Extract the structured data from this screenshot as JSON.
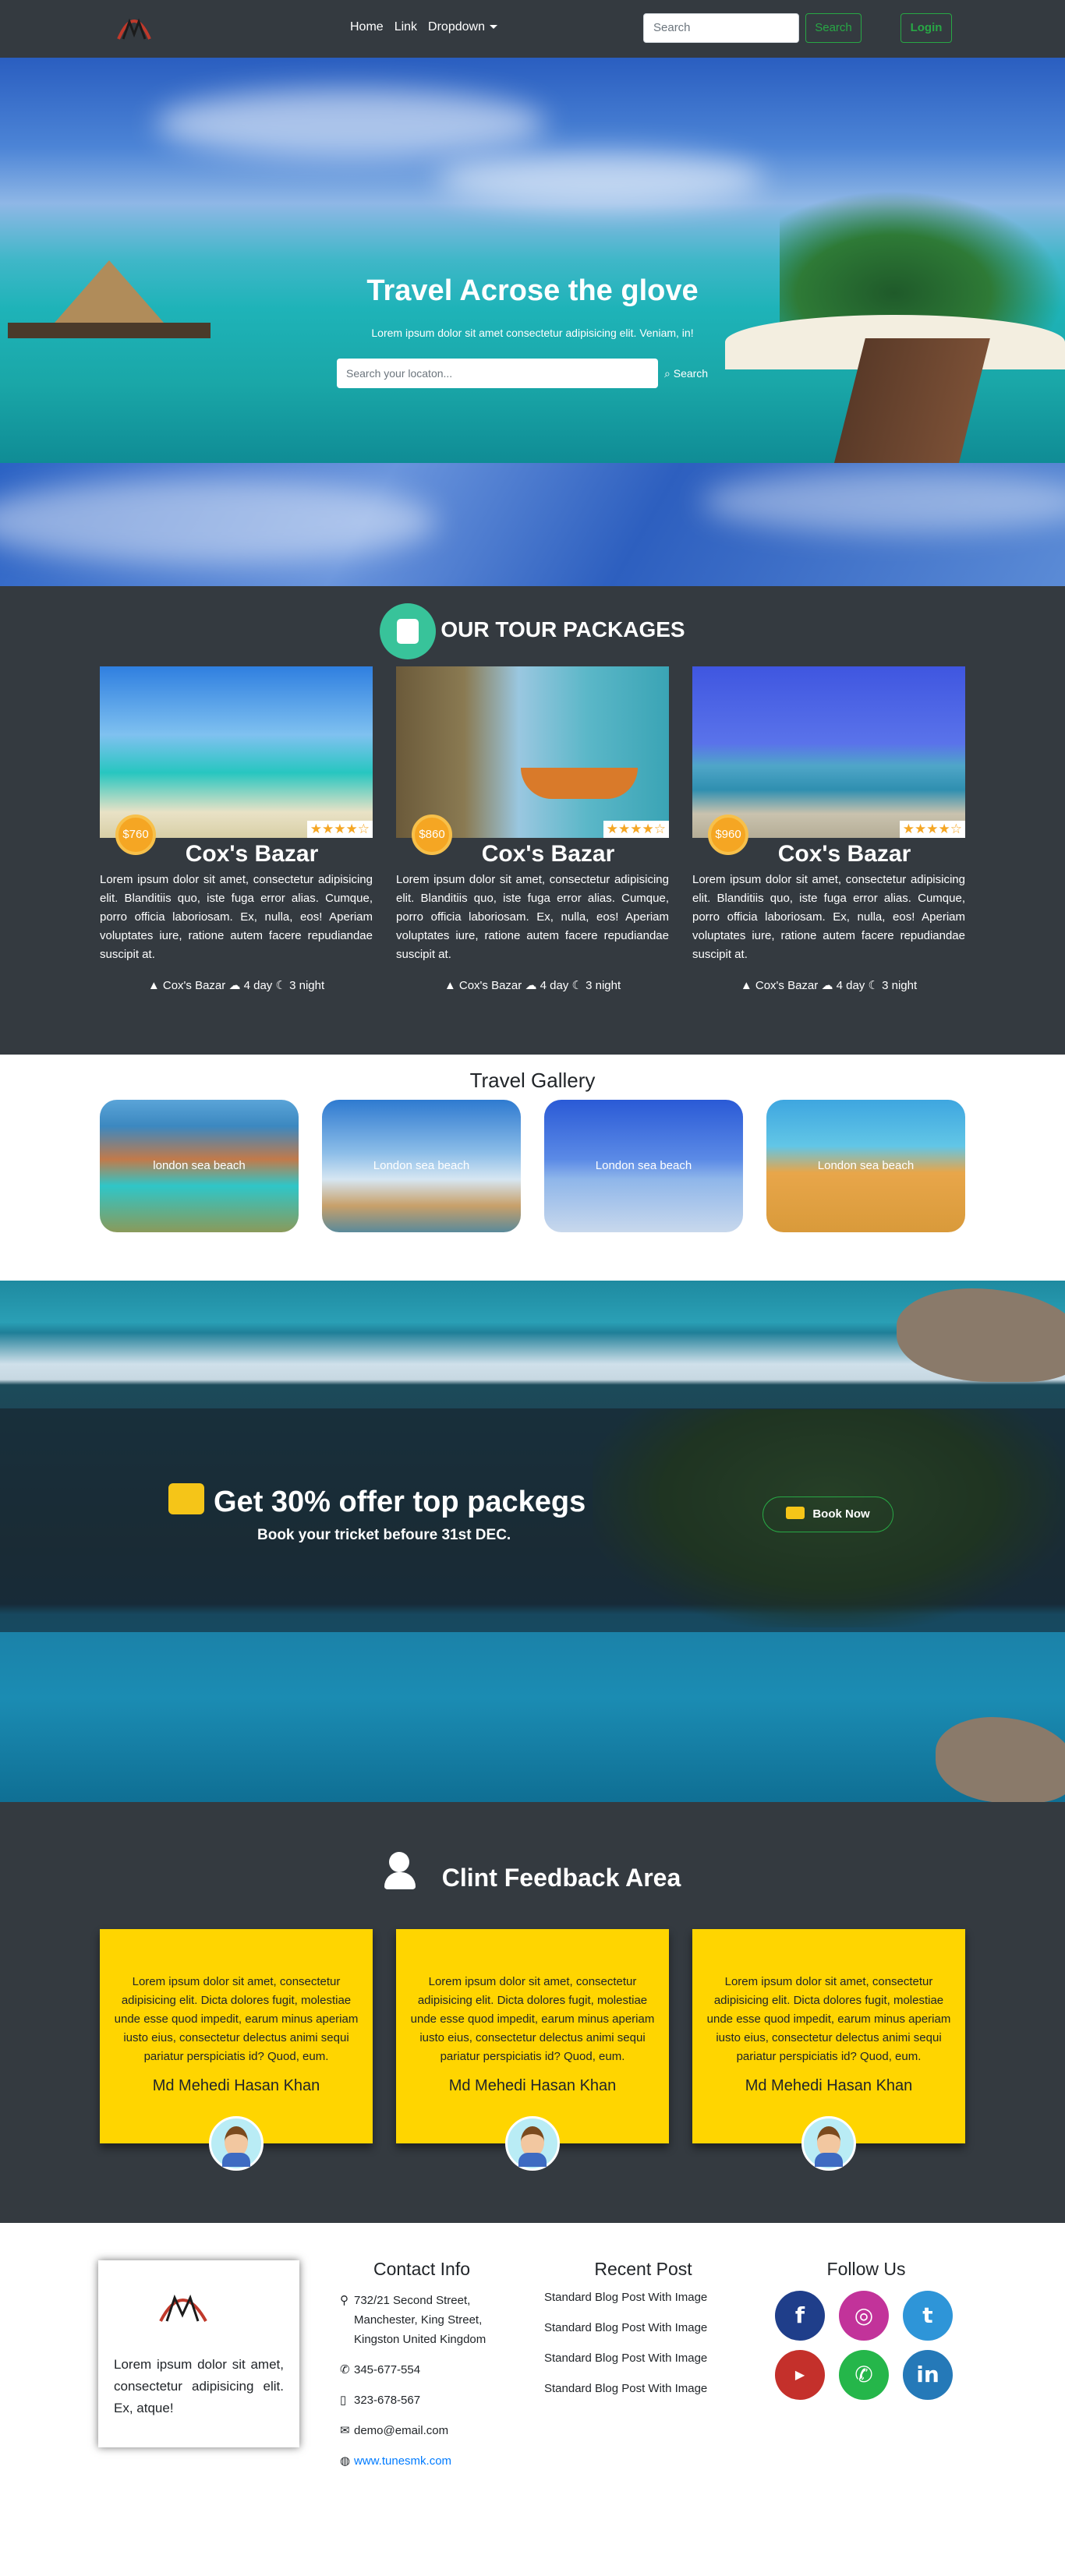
{
  "nav": {
    "links": [
      "Home",
      "Link",
      "Dropdown"
    ],
    "search_placeholder": "Search",
    "search_button": "Search",
    "login_button": "Login"
  },
  "hero": {
    "title": "Travel Acrose the glove",
    "subtitle": "Lorem ipsum dolor sit amet consectetur adipisicing elit. Veniam, in!",
    "search_placeholder": "Search your locaton...",
    "search_button": "Search"
  },
  "packages": {
    "heading": "OUR TOUR PACKAGES",
    "cards": [
      {
        "price": "$760",
        "stars": "★★★★☆",
        "title": "Cox's Bazar",
        "desc": "Lorem ipsum dolor sit amet, consectetur adipisicing elit. Blanditiis quo, iste fuga error alias. Cumque, porro officia laboriosam. Ex, nulla, eos! Aperiam voluptates iure, ratione autem facere repudiandae suscipit at.",
        "location": "Cox's Bazar",
        "days": "4 day",
        "nights": "3 night"
      },
      {
        "price": "$860",
        "stars": "★★★★☆",
        "title": "Cox's Bazar",
        "desc": "Lorem ipsum dolor sit amet, consectetur adipisicing elit. Blanditiis quo, iste fuga error alias. Cumque, porro officia laboriosam. Ex, nulla, eos! Aperiam voluptates iure, ratione autem facere repudiandae suscipit at.",
        "location": "Cox's Bazar",
        "days": "4 day",
        "nights": "3 night"
      },
      {
        "price": "$960",
        "stars": "★★★★☆",
        "title": "Cox's Bazar",
        "desc": "Lorem ipsum dolor sit amet, consectetur adipisicing elit. Blanditiis quo, iste fuga error alias. Cumque, porro officia laboriosam. Ex, nulla, eos! Aperiam voluptates iure, ratione autem facere repudiandae suscipit at.",
        "location": "Cox's Bazar",
        "days": "4 day",
        "nights": "3 night"
      }
    ]
  },
  "gallery": {
    "heading": "Travel Gallery",
    "items": [
      "london sea beach",
      "London sea beach",
      "London sea beach",
      "London sea beach"
    ]
  },
  "offer": {
    "title": "Get 30% offer top packegs",
    "subtitle": "Book your tricket befoure 31st DEC.",
    "button": "Book Now"
  },
  "feedback": {
    "heading": "Clint Feedback Area",
    "cards": [
      {
        "text": "Lorem ipsum dolor sit amet, consectetur adipisicing elit. Dicta dolores fugit, molestiae unde esse quod impedit, earum minus aperiam iusto eius, consectetur delectus animi sequi pariatur perspiciatis id? Quod, eum.",
        "name": "Md Mehedi Hasan Khan"
      },
      {
        "text": "Lorem ipsum dolor sit amet, consectetur adipisicing elit. Dicta dolores fugit, molestiae unde esse quod impedit, earum minus aperiam iusto eius, consectetur delectus animi sequi pariatur perspiciatis id? Quod, eum.",
        "name": "Md Mehedi Hasan Khan"
      },
      {
        "text": "Lorem ipsum dolor sit amet, consectetur adipisicing elit. Dicta dolores fugit, molestiae unde esse quod impedit, earum minus aperiam iusto eius, consectetur delectus animi sequi pariatur perspiciatis id? Quod, eum.",
        "name": "Md Mehedi Hasan Khan"
      }
    ]
  },
  "footer": {
    "about": "Lorem ipsum dolor sit amet, consectetur adipisicing elit. Ex, atque!",
    "contact": {
      "heading": "Contact Info",
      "address": "732/21 Second Street, Manchester, King Street, Kingston United Kingdom",
      "phone1": "345-677-554",
      "phone2": "323-678-567",
      "email": "demo@email.com",
      "website": "www.tunesmk.com"
    },
    "recent": {
      "heading": "Recent Post",
      "posts": [
        "Standard Blog Post With Image",
        "Standard Blog Post With Image",
        "Standard Blog Post With Image",
        "Standard Blog Post With Image"
      ]
    },
    "follow": {
      "heading": "Follow Us"
    }
  },
  "icons": {
    "social": [
      "facebook-icon",
      "instagram-icon",
      "twitter-icon",
      "youtube-icon",
      "whatsapp-icon",
      "linkedin-icon"
    ]
  },
  "colors": {
    "dark": "#343a40",
    "green": "#28a745",
    "accent_yellow": "#ffd500",
    "price_orange": "#f5a623"
  }
}
